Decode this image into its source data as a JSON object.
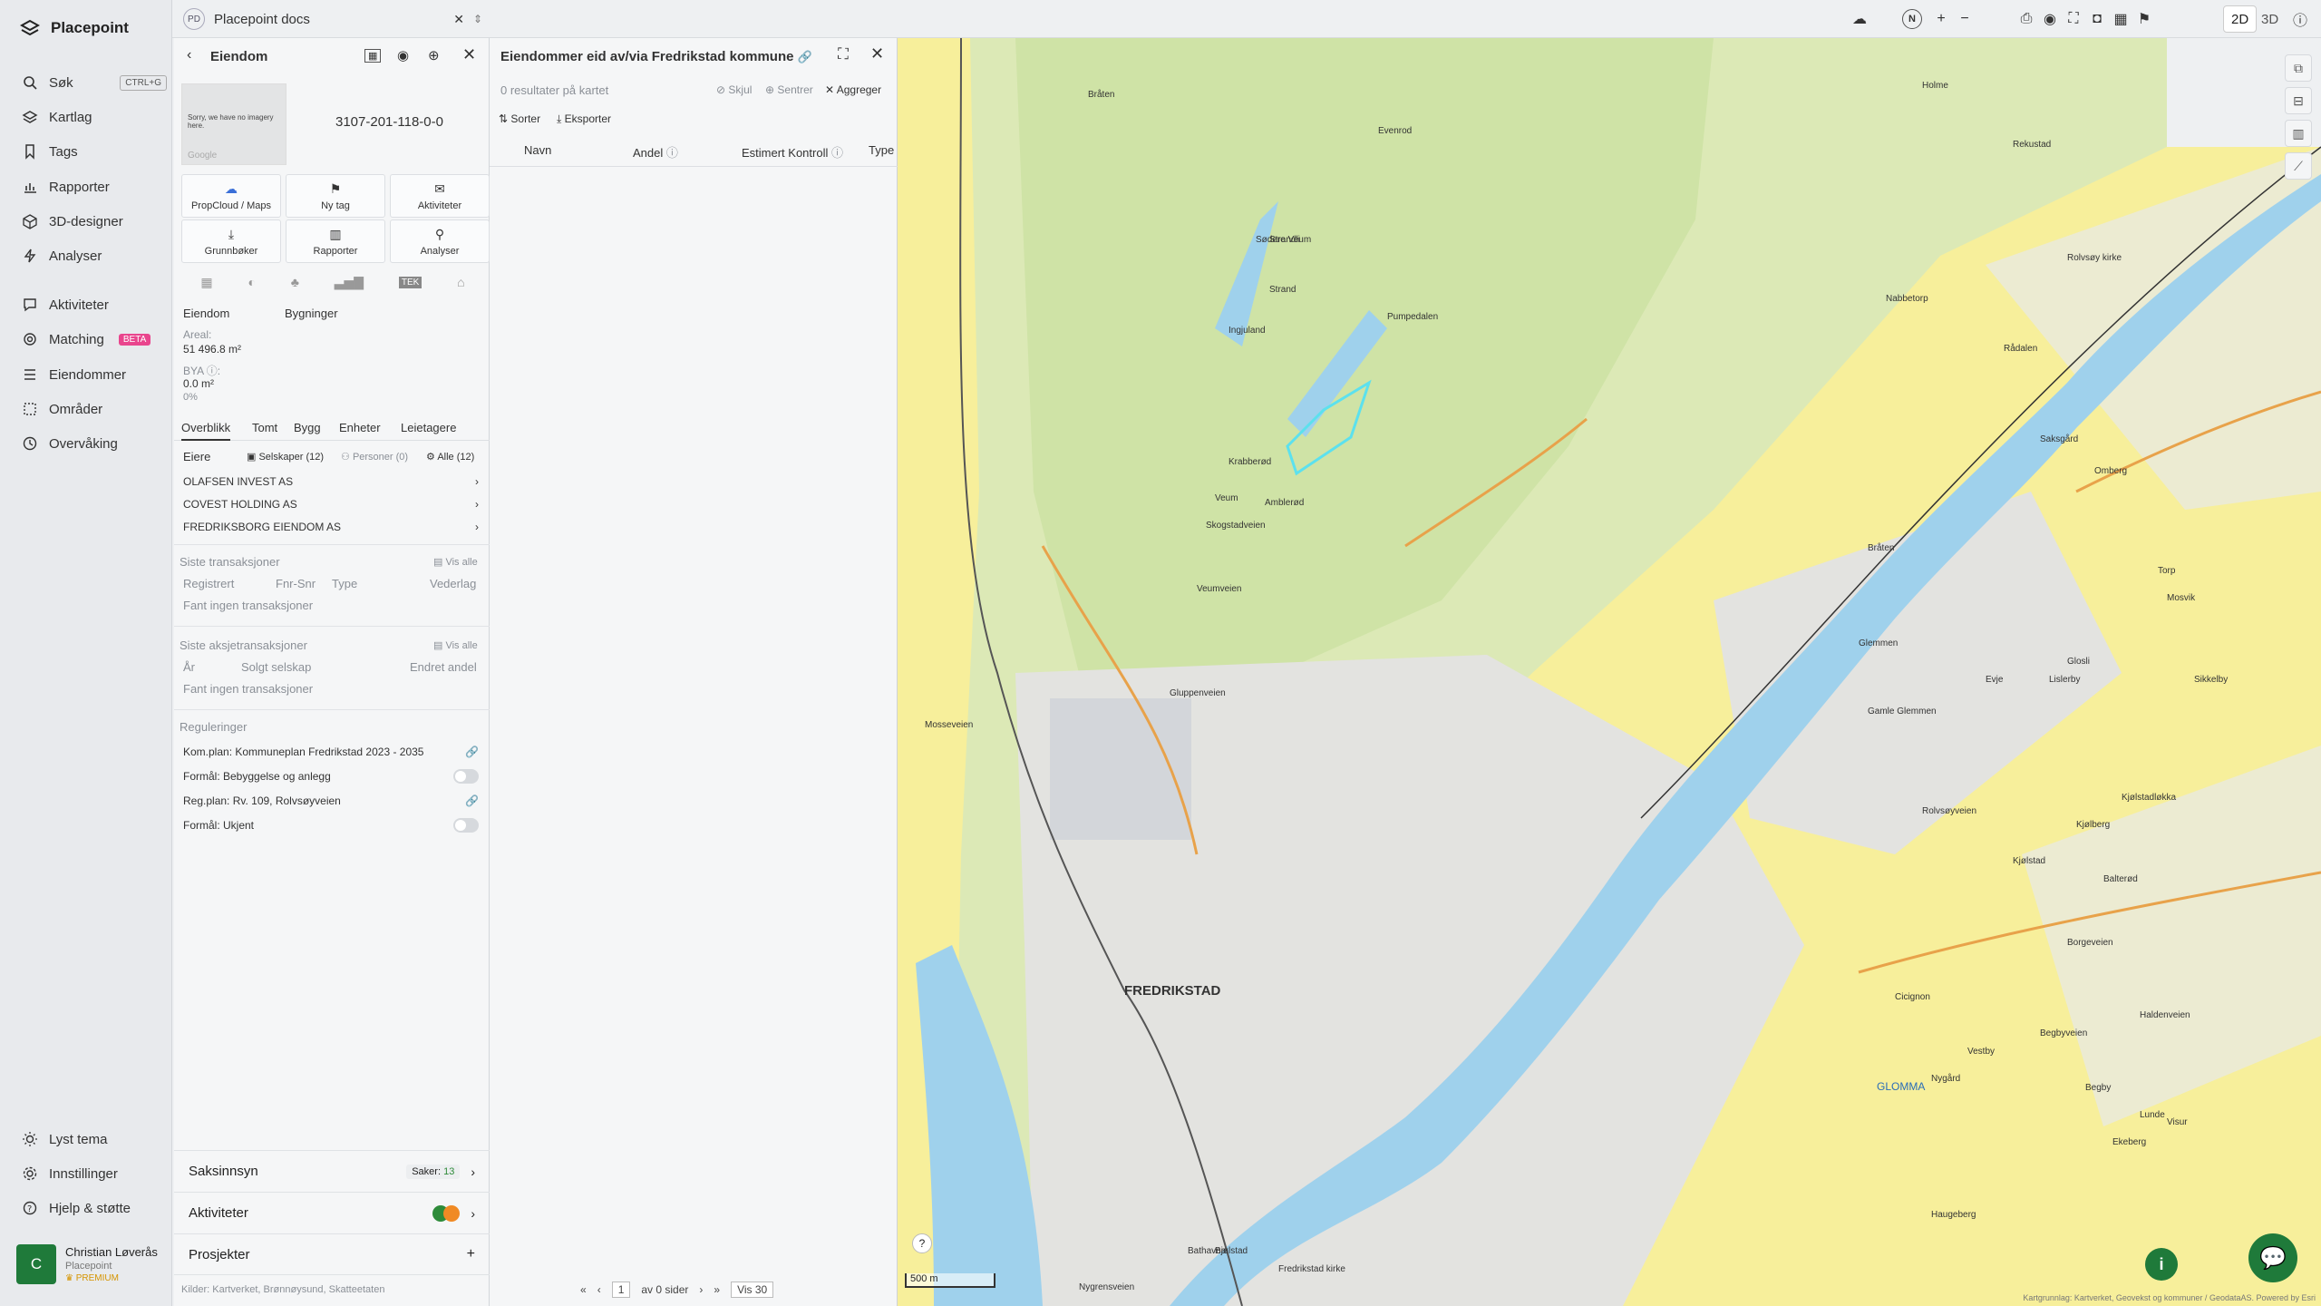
{
  "app": {
    "name": "Placepoint"
  },
  "nav": {
    "items": [
      {
        "label": "Søk",
        "shortcut": "CTRL+G",
        "icon": "search-icon"
      },
      {
        "label": "Kartlag",
        "icon": "layers-icon"
      },
      {
        "label": "Tags",
        "icon": "bookmark-icon"
      },
      {
        "label": "Rapporter",
        "icon": "chart-icon"
      },
      {
        "label": "3D-designer",
        "icon": "cube-icon"
      },
      {
        "label": "Analyser",
        "icon": "lightning-icon"
      },
      {
        "label": "Aktiviteter",
        "icon": "chat-icon"
      },
      {
        "label": "Matching",
        "badge": "BETA",
        "icon": "target-icon"
      },
      {
        "label": "Eiendommer",
        "icon": "list-icon"
      },
      {
        "label": "Områder",
        "icon": "dashed-square-icon"
      },
      {
        "label": "Overvåking",
        "icon": "clock-icon"
      }
    ],
    "bottom": [
      {
        "label": "Lyst tema",
        "icon": "sun-icon"
      },
      {
        "label": "Innstillinger",
        "icon": "gear-icon"
      },
      {
        "label": "Hjelp & støtte",
        "icon": "help-icon"
      }
    ],
    "user": {
      "initial": "C",
      "name": "Christian Løverås",
      "org": "Placepoint",
      "tier": "PREMIUM"
    }
  },
  "tab": {
    "badge": "PD",
    "title": "Placepoint docs"
  },
  "toolbar": {
    "mode_2d": "2D",
    "mode_3d": "3D"
  },
  "property": {
    "header": "Eiendom",
    "image_text": "Sorry, we have no imagery here.",
    "image_credit": "Google",
    "id": "3107-201-118-0-0",
    "actions": [
      "PropCloud / Maps",
      "Ny tag",
      "Aktiviteter",
      "Grunnbøker",
      "Rapporter",
      "Analyser"
    ],
    "tek": "TEK",
    "summary_cols": [
      "Eiendom",
      "Bygninger"
    ],
    "area_label": "Areal:",
    "area_value": "51 496.8 m²",
    "bya_label": "BYA ⓘ:",
    "bya_value": "0.0 m²",
    "bya_pct": "0%",
    "subtabs": [
      "Overblikk",
      "Tomt",
      "Bygg",
      "Enheter",
      "Leietagere"
    ],
    "owners_label": "Eiere",
    "companies": "Selskaper (12)",
    "persons": "Personer (0)",
    "all": "Alle (12)",
    "owners": [
      "OLAFSEN INVEST AS",
      "COVEST HOLDING AS",
      "FREDRIKSBORG EIENDOM AS"
    ],
    "tx_title": "Siste transaksjoner",
    "show_all": "Vis alle",
    "tx_cols": [
      "Registrert",
      "Fnr-Snr",
      "Type",
      "Vederlag"
    ],
    "tx_empty": "Fant ingen transaksjoner",
    "stx_title": "Siste aksjetransaksjoner",
    "stx_cols": [
      "År",
      "Solgt selskap",
      "Endret andel"
    ],
    "stx_empty": "Fant ingen transaksjoner",
    "reg_title": "Reguleringer",
    "reg": [
      "Kom.plan: Kommuneplan Fredrikstad 2023 - 2035",
      "Formål: Bebyggelse og anlegg",
      "Reg.plan: Rv. 109, Rolvsøyveien",
      "Formål: Ukjent"
    ],
    "saksinnsyn": "Saksinnsyn",
    "saker_label": "Saker:",
    "saker_count": "13",
    "aktiviteter": "Aktiviteter",
    "prosjekter": "Prosjekter",
    "sources_label": "Kilder:",
    "sources": [
      "Kartverket",
      "Brønnøysund",
      "Skatteetaten"
    ]
  },
  "list": {
    "title": "Eiendommer eid av/via Fredrikstad kommune",
    "results": "0 resultater på kartet",
    "hide": "Skjul",
    "center": "Sentrer",
    "aggregate": "Aggreger",
    "sort": "Sorter",
    "export": "Eksporter",
    "columns": [
      "Navn",
      "Andel",
      "Estimert Kontroll",
      "Type"
    ],
    "page": "1",
    "of_pages": "av 0 sider",
    "per_page": "Vis 30"
  },
  "map": {
    "labels": [
      "Bråten",
      "Evenrod",
      "Veum",
      "Sødere Veum",
      "Holme",
      "Rekustad",
      "Rolvsøy kirke",
      "Pumpedalen",
      "Strandli",
      "Strand",
      "Ingjuland",
      "Krabberød",
      "Amblerød",
      "Skogstadveien",
      "Veumveien",
      "Bråten",
      "Glemmen",
      "Gamle Glemmen",
      "Evje",
      "Nabbetorp",
      "Rådalen",
      "Saksgård",
      "Omberg",
      "Mosseveien",
      "Glosli",
      "Kjølberg",
      "FREDRIKSTAD",
      "Gluppenveien",
      "Rolvsøyveien",
      "Lislerby",
      "Kjølstad",
      "Kjølstadløkka",
      "Balterød",
      "Borgeveien",
      "Haldenveien",
      "Begby",
      "Ekeberg",
      "Lunde",
      "Visur",
      "GLOMMA",
      "Bjølstad",
      "Nygrensveien",
      "Bathavna",
      "Fredrikstad kirke",
      "Torp",
      "Mosvik",
      "Sikkelby",
      "Begbyveien",
      "Nygård",
      "Vestby",
      "Cicignon",
      "Haugeberg"
    ],
    "scale": "500 m",
    "attribution": "Kartgrunnlag: Kartverket, Geovekst og kommuner / GeodataAS. Powered by Esri"
  }
}
